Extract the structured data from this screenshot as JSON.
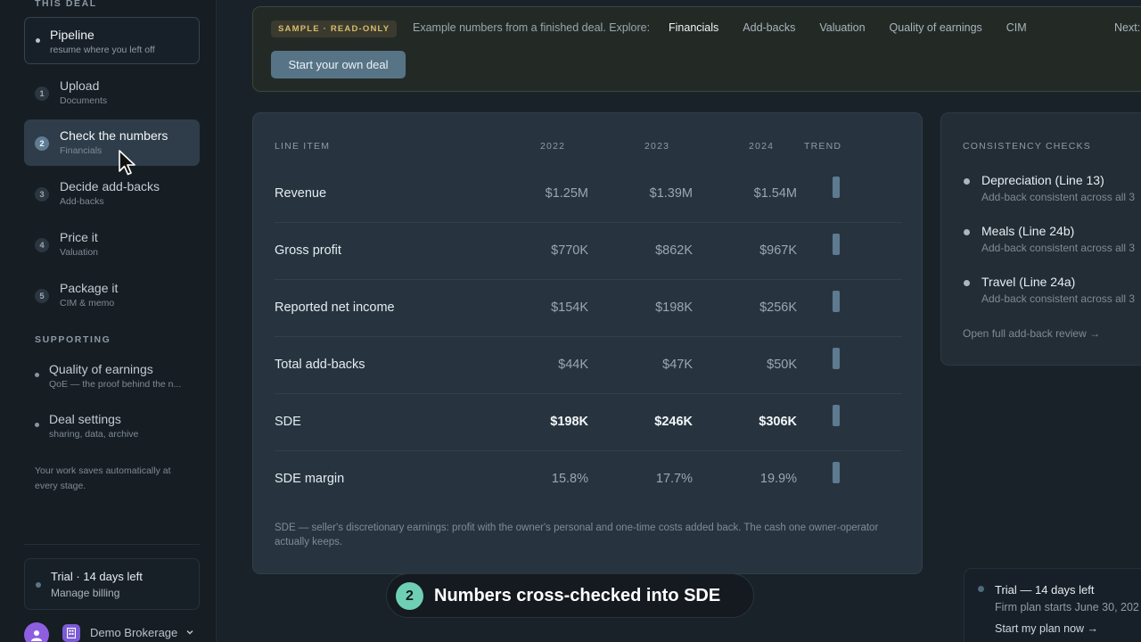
{
  "sidebar": {
    "section_this_deal": "THIS DEAL",
    "pipeline": {
      "title": "Pipeline",
      "subtitle": "resume where you left off"
    },
    "steps": [
      {
        "num": "1",
        "title": "Upload",
        "subtitle": "Documents"
      },
      {
        "num": "2",
        "title": "Check the numbers",
        "subtitle": "Financials"
      },
      {
        "num": "3",
        "title": "Decide add-backs",
        "subtitle": "Add-backs"
      },
      {
        "num": "4",
        "title": "Price it",
        "subtitle": "Valuation"
      },
      {
        "num": "5",
        "title": "Package it",
        "subtitle": "CIM & memo"
      }
    ],
    "section_supporting": "SUPPORTING",
    "supporting": [
      {
        "title": "Quality of earnings",
        "subtitle": "QoE — the proof behind the n..."
      },
      {
        "title": "Deal settings",
        "subtitle": "sharing, data, archive"
      }
    ],
    "autosave": "Your work saves automatically at every stage.",
    "trial": {
      "title": "Trial · 14 days left",
      "subtitle": "Manage billing"
    },
    "org": {
      "name": "Demo Brokerage"
    }
  },
  "banner": {
    "badge": "SAMPLE · READ-ONLY",
    "text": "Example numbers from a finished deal. Explore:",
    "links": [
      "Financials",
      "Add-backs",
      "Valuation",
      "Quality of earnings",
      "CIM"
    ],
    "next": "Next:",
    "start_button": "Start your own deal"
  },
  "financials": {
    "headers": {
      "line_item": "LINE ITEM",
      "y1": "2022",
      "y2": "2023",
      "y3": "2024",
      "trend": "TREND"
    },
    "rows": [
      {
        "label": "Revenue",
        "values": [
          "$1.25M",
          "$1.39M",
          "$1.54M"
        ]
      },
      {
        "label": "Gross profit",
        "values": [
          "$770K",
          "$862K",
          "$967K"
        ]
      },
      {
        "label": "Reported net income",
        "values": [
          "$154K",
          "$198K",
          "$256K"
        ]
      },
      {
        "label": "Total add-backs",
        "values": [
          "$44K",
          "$47K",
          "$50K"
        ]
      },
      {
        "label": "SDE",
        "values": [
          "$198K",
          "$246K",
          "$306K"
        ]
      },
      {
        "label": "SDE margin",
        "values": [
          "15.8%",
          "17.7%",
          "19.9%"
        ]
      }
    ],
    "footnote": "SDE — seller's discretionary earnings: profit with the owner's personal and one-time costs added back. The cash one owner-operator actually keeps."
  },
  "checks": {
    "title": "CONSISTENCY CHECKS",
    "items": [
      {
        "title": "Depreciation (Line 13)",
        "subtitle": "Add-back consistent across all 3"
      },
      {
        "title": "Meals (Line 24b)",
        "subtitle": "Add-back consistent across all 3"
      },
      {
        "title": "Travel (Line 24a)",
        "subtitle": "Add-back consistent across all 3"
      }
    ],
    "link": "Open full add-back review →"
  },
  "trial_card": {
    "title": "Trial — 14 days left",
    "subtitle": "Firm plan starts June 30, 202",
    "link": "Start my plan now →"
  },
  "caption": {
    "num": "2",
    "text": "Numbers cross-checked into SDE"
  },
  "colors": {
    "accent": "#577487",
    "badge": "#d8bd6c",
    "caption_circle": "#6fcfb5",
    "avatar": "#8d5fe0"
  }
}
